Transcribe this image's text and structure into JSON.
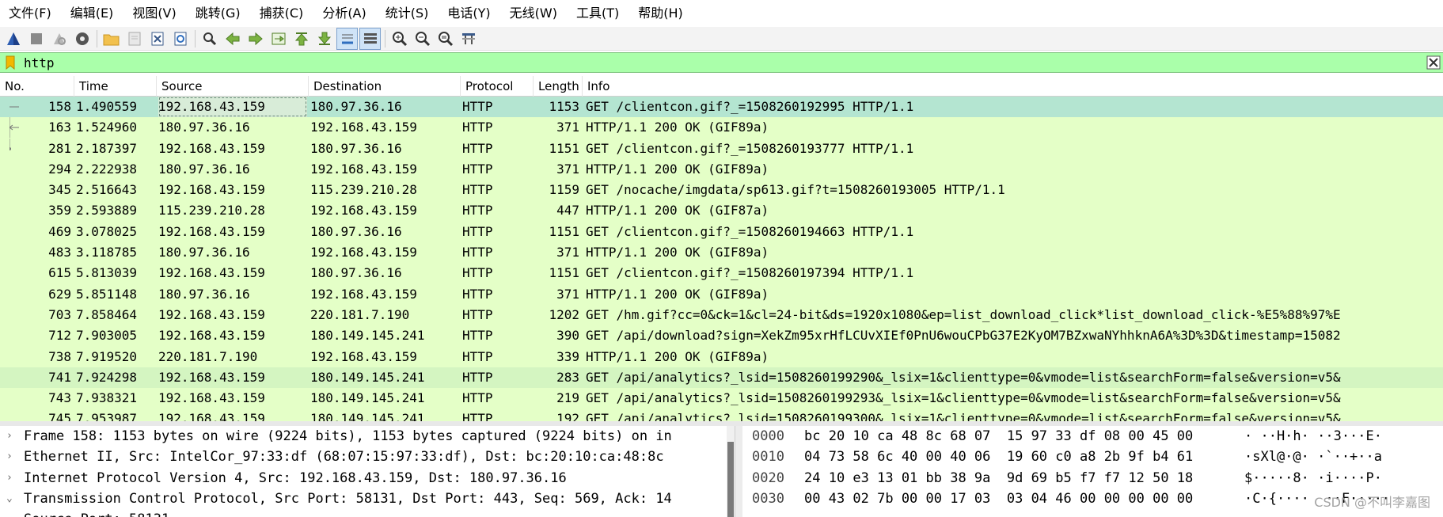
{
  "menu": [
    "文件(F)",
    "编辑(E)",
    "视图(V)",
    "跳转(G)",
    "捕获(C)",
    "分析(A)",
    "统计(S)",
    "电话(Y)",
    "无线(W)",
    "工具(T)",
    "帮助(H)"
  ],
  "toolbar": {
    "icons": [
      "start-capture-icon",
      "stop-capture-icon",
      "restart-capture-icon",
      "capture-options-icon",
      "open-file-icon",
      "save-file-icon",
      "close-file-icon",
      "reload-file-icon",
      "find-packet-icon",
      "go-back-icon",
      "go-forward-icon",
      "go-to-packet-icon",
      "go-first-icon",
      "go-last-icon",
      "auto-scroll-icon",
      "colorize-icon",
      "zoom-in-icon",
      "zoom-out-icon",
      "zoom-normal-icon",
      "resize-columns-icon"
    ]
  },
  "filter": {
    "value": "http"
  },
  "columns": [
    "No.",
    "Time",
    "Source",
    "Destination",
    "Protocol",
    "Length",
    "Info"
  ],
  "packets": [
    {
      "no": "158",
      "time": "1.490559",
      "src": "192.168.43.159",
      "dst": "180.97.36.16",
      "proto": "HTTP",
      "len": "1153",
      "info": "GET /clientcon.gif?_=1508260192995 HTTP/1.1"
    },
    {
      "no": "163",
      "time": "1.524960",
      "src": "180.97.36.16",
      "dst": "192.168.43.159",
      "proto": "HTTP",
      "len": "371",
      "info": "HTTP/1.1 200 OK  (GIF89a)"
    },
    {
      "no": "281",
      "time": "2.187397",
      "src": "192.168.43.159",
      "dst": "180.97.36.16",
      "proto": "HTTP",
      "len": "1151",
      "info": "GET /clientcon.gif?_=1508260193777 HTTP/1.1"
    },
    {
      "no": "294",
      "time": "2.222938",
      "src": "180.97.36.16",
      "dst": "192.168.43.159",
      "proto": "HTTP",
      "len": "371",
      "info": "HTTP/1.1 200 OK  (GIF89a)"
    },
    {
      "no": "345",
      "time": "2.516643",
      "src": "192.168.43.159",
      "dst": "115.239.210.28",
      "proto": "HTTP",
      "len": "1159",
      "info": "GET /nocache/imgdata/sp613.gif?t=1508260193005 HTTP/1.1"
    },
    {
      "no": "359",
      "time": "2.593889",
      "src": "115.239.210.28",
      "dst": "192.168.43.159",
      "proto": "HTTP",
      "len": "447",
      "info": "HTTP/1.1 200 OK  (GIF87a)"
    },
    {
      "no": "469",
      "time": "3.078025",
      "src": "192.168.43.159",
      "dst": "180.97.36.16",
      "proto": "HTTP",
      "len": "1151",
      "info": "GET /clientcon.gif?_=1508260194663 HTTP/1.1"
    },
    {
      "no": "483",
      "time": "3.118785",
      "src": "180.97.36.16",
      "dst": "192.168.43.159",
      "proto": "HTTP",
      "len": "371",
      "info": "HTTP/1.1 200 OK  (GIF89a)"
    },
    {
      "no": "615",
      "time": "5.813039",
      "src": "192.168.43.159",
      "dst": "180.97.36.16",
      "proto": "HTTP",
      "len": "1151",
      "info": "GET /clientcon.gif?_=1508260197394 HTTP/1.1"
    },
    {
      "no": "629",
      "time": "5.851148",
      "src": "180.97.36.16",
      "dst": "192.168.43.159",
      "proto": "HTTP",
      "len": "371",
      "info": "HTTP/1.1 200 OK  (GIF89a)"
    },
    {
      "no": "703",
      "time": "7.858464",
      "src": "192.168.43.159",
      "dst": "220.181.7.190",
      "proto": "HTTP",
      "len": "1202",
      "info": "GET /hm.gif?cc=0&ck=1&cl=24-bit&ds=1920x1080&ep=list_download_click*list_download_click-%E5%88%97%E"
    },
    {
      "no": "712",
      "time": "7.903005",
      "src": "192.168.43.159",
      "dst": "180.149.145.241",
      "proto": "HTTP",
      "len": "390",
      "info": "GET /api/download?sign=XekZm95xrHfLCUvXIEf0PnU6wouCPbG37E2KyOM7BZxwaNYhhknA6A%3D%3D&timestamp=15082"
    },
    {
      "no": "738",
      "time": "7.919520",
      "src": "220.181.7.190",
      "dst": "192.168.43.159",
      "proto": "HTTP",
      "len": "339",
      "info": "HTTP/1.1 200 OK  (GIF89a)"
    },
    {
      "no": "741",
      "time": "7.924298",
      "src": "192.168.43.159",
      "dst": "180.149.145.241",
      "proto": "HTTP",
      "len": "283",
      "info": "GET /api/analytics?_lsid=1508260199290&_lsix=1&clienttype=0&vmode=list&searchForm=false&version=v5&"
    },
    {
      "no": "743",
      "time": "7.938321",
      "src": "192.168.43.159",
      "dst": "180.149.145.241",
      "proto": "HTTP",
      "len": "219",
      "info": "GET /api/analytics?_lsid=1508260199293&_lsix=1&clienttype=0&vmode=list&searchForm=false&version=v5&"
    },
    {
      "no": "745",
      "time": "7.953987",
      "src": "192.168.43.159",
      "dst": "180.149.145.241",
      "proto": "HTTP",
      "len": "192",
      "info": "GET /api/analytics?_lsid=1508260199300&_lsix=1&clienttype=0&vmode=list&searchForm=false&version=v5&"
    }
  ],
  "details": [
    {
      "arrow": "›",
      "text": "Frame 158: 1153 bytes on wire (9224 bits), 1153 bytes captured (9224 bits) on in"
    },
    {
      "arrow": "›",
      "text": "Ethernet II, Src: IntelCor_97:33:df (68:07:15:97:33:df), Dst: bc:20:10:ca:48:8c"
    },
    {
      "arrow": "›",
      "text": "Internet Protocol Version 4, Src: 192.168.43.159, Dst: 180.97.36.16"
    },
    {
      "arrow": "⌄",
      "text": "Transmission Control Protocol, Src Port: 58131, Dst Port: 443, Seq: 569, Ack: 14"
    },
    {
      "arrow": "",
      "text": "    Source Port: 58131"
    }
  ],
  "bytes": [
    {
      "off": "0000",
      "hex": "bc 20 10 ca 48 8c 68 07  15 97 33 df 08 00 45 00",
      "ascii": "· ··H·h· ··3···E·"
    },
    {
      "off": "0010",
      "hex": "04 73 58 6c 40 00 40 06  19 60 c0 a8 2b 9f b4 61",
      "ascii": "·sXl@·@· ·`··+··a"
    },
    {
      "off": "0020",
      "hex": "24 10 e3 13 01 bb 38 9a  9d 69 b5 f7 f7 12 50 18",
      "ascii": "$·····8· ·i····P·"
    },
    {
      "off": "0030",
      "hex": "00 43 02 7b 00 00 17 03  03 04 46 00 00 00 00 00",
      "ascii": "·C·{····  ··F·····"
    }
  ],
  "watermark": "CSDN @不叫李嘉图"
}
